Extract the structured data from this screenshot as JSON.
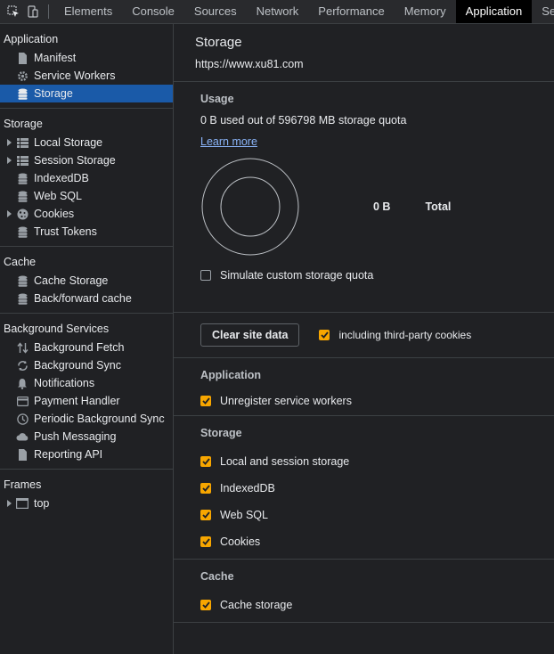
{
  "toolbar": {
    "tabs": [
      "Elements",
      "Console",
      "Sources",
      "Network",
      "Performance",
      "Memory",
      "Application",
      "Secu"
    ],
    "active_tab": "Application"
  },
  "sidebar": {
    "application": {
      "title": "Application",
      "items": [
        {
          "label": "Manifest",
          "icon": "file-icon"
        },
        {
          "label": "Service Workers",
          "icon": "gear-icon"
        },
        {
          "label": "Storage",
          "icon": "database-icon",
          "selected": true
        }
      ]
    },
    "storage": {
      "title": "Storage",
      "items": [
        {
          "label": "Local Storage",
          "icon": "grid-icon",
          "expandable": true
        },
        {
          "label": "Session Storage",
          "icon": "grid-icon",
          "expandable": true
        },
        {
          "label": "IndexedDB",
          "icon": "database-icon"
        },
        {
          "label": "Web SQL",
          "icon": "database-icon"
        },
        {
          "label": "Cookies",
          "icon": "cookie-icon",
          "expandable": true
        },
        {
          "label": "Trust Tokens",
          "icon": "database-icon"
        }
      ]
    },
    "cache": {
      "title": "Cache",
      "items": [
        {
          "label": "Cache Storage",
          "icon": "database-icon"
        },
        {
          "label": "Back/forward cache",
          "icon": "database-icon"
        }
      ]
    },
    "background": {
      "title": "Background Services",
      "items": [
        {
          "label": "Background Fetch",
          "icon": "arrows-updown-icon"
        },
        {
          "label": "Background Sync",
          "icon": "sync-icon"
        },
        {
          "label": "Notifications",
          "icon": "bell-icon"
        },
        {
          "label": "Payment Handler",
          "icon": "card-icon"
        },
        {
          "label": "Periodic Background Sync",
          "icon": "clock-icon"
        },
        {
          "label": "Push Messaging",
          "icon": "cloud-icon"
        },
        {
          "label": "Reporting API",
          "icon": "document-icon"
        }
      ]
    },
    "frames": {
      "title": "Frames",
      "items": [
        {
          "label": "top",
          "icon": "frame-icon",
          "expandable": true
        }
      ]
    }
  },
  "main": {
    "title": "Storage",
    "origin": "https://www.xu81.com",
    "usage": {
      "heading": "Usage",
      "summary": "0 B used out of 596798 MB storage quota",
      "learn_more": "Learn more",
      "total_value": "0 B",
      "total_label": "Total",
      "simulate_label": "Simulate custom storage quota",
      "simulate_checked": false
    },
    "clear": {
      "button": "Clear site data",
      "third_party_label": "including third-party cookies",
      "third_party_checked": true
    },
    "application_section": {
      "heading": "Application",
      "options": [
        {
          "label": "Unregister service workers",
          "checked": true
        }
      ]
    },
    "storage_section": {
      "heading": "Storage",
      "options": [
        {
          "label": "Local and session storage",
          "checked": true
        },
        {
          "label": "IndexedDB",
          "checked": true
        },
        {
          "label": "Web SQL",
          "checked": true
        },
        {
          "label": "Cookies",
          "checked": true
        }
      ]
    },
    "cache_section": {
      "heading": "Cache",
      "options": [
        {
          "label": "Cache storage",
          "checked": true
        }
      ]
    }
  },
  "colors": {
    "accent": "#f7a600",
    "selected": "#1a5aa8",
    "link": "#8ab4f8"
  }
}
